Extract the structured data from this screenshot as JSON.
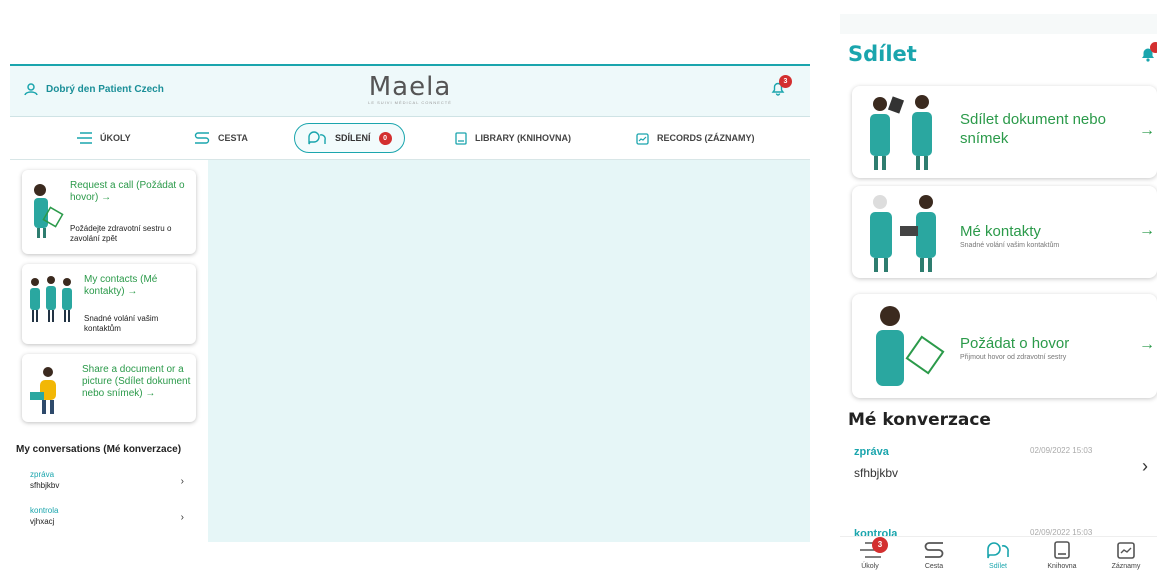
{
  "desktop": {
    "greeting": "Dobrý den Patient Czech",
    "logo": "Maela",
    "logo_tagline": "LE SUIVI MÉDICAL CONNECTÉ",
    "notif_count": "3",
    "tabs": [
      {
        "label": "ÚKOLY",
        "icon": "list-icon"
      },
      {
        "label": "CESTA",
        "icon": "path-icon"
      },
      {
        "label": "SDÍLENÍ",
        "icon": "share-icon",
        "badge": "0"
      },
      {
        "label": "LIBRARY (KNIHOVNA)",
        "icon": "book-icon"
      },
      {
        "label": "RECORDS (ZÁZNAMY)",
        "icon": "records-icon"
      }
    ],
    "cards": [
      {
        "title": "Request a call (Požádat o hovor) →",
        "desc": "Požádejte zdravotní sestru o zavolání zpět"
      },
      {
        "title": "My contacts (Mé kontakty) →",
        "desc": "Snadné volání vašim kontaktům"
      },
      {
        "title": "Share a document or a picture (Sdílet dokument nebo snímek) →",
        "desc": ""
      }
    ],
    "conversations_title": "My conversations (Mé konverzace)",
    "conversations": [
      {
        "type": "zpráva",
        "text": "sfhbjkbv"
      },
      {
        "type": "kontrola",
        "text": "vjhxacj"
      }
    ]
  },
  "mobile": {
    "title": "Sdílet",
    "cards": [
      {
        "title_l1": "Sdílet dokument nebo",
        "title_l2": "snímek",
        "desc": ""
      },
      {
        "title_l1": "Mé kontakty",
        "title_l2": "",
        "desc": "Snadné volání vašim kontaktům"
      },
      {
        "title_l1": "Požádat o hovor",
        "title_l2": "",
        "desc": "Přijmout hovor od zdravotní sestry"
      }
    ],
    "conversations_title": "Mé konverzace",
    "conversation": {
      "type": "zpráva",
      "text": "sfhbjkbv",
      "date": "02/09/2022 15:03"
    },
    "conversation2": {
      "type": "kontrola",
      "date": "02/09/2022 15:03"
    },
    "nav": [
      {
        "label": "Úkoly",
        "badge": "3"
      },
      {
        "label": "Cesta"
      },
      {
        "label": "Sdílet"
      },
      {
        "label": "Knihovna"
      },
      {
        "label": "Záznamy"
      }
    ]
  },
  "colors": {
    "accent": "#1aa5ad",
    "green": "#2b9a4a",
    "badge": "#d32f2f"
  }
}
